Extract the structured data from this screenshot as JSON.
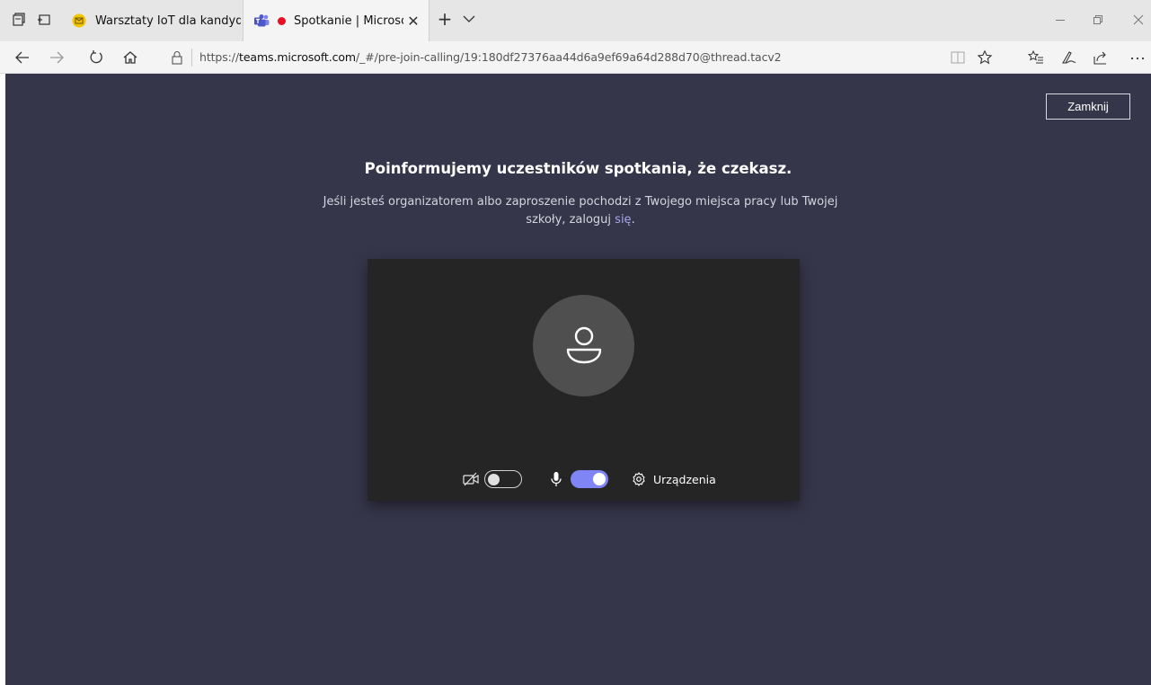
{
  "browser": {
    "tabs": [
      {
        "title": "Warsztaty IoT dla kandydatów",
        "active": false
      },
      {
        "title": "Spotkanie | Microsoft Teams",
        "active": true,
        "recording": true
      }
    ],
    "url_host_prefix": "https://",
    "url_host": "teams.microsoft.com",
    "url_path": "/_#/pre-join-calling/19:180df27376aa44d6a9ef69a64d288d70@thread.tacv2"
  },
  "page": {
    "close_label": "Zamknij",
    "headline": "Poinformujemy uczestników spotkania, że czekasz.",
    "subtitle_line1": "Jeśli jesteś organizatorem albo zaproszenie pochodzi z Twojego miejsca pracy lub Twojej",
    "subtitle_line2": "szkoły, zaloguj",
    "signin_link": "się",
    "subtitle_end": ".",
    "devices_label": "Urządzenia",
    "camera_on": false,
    "mic_on": true
  },
  "colors": {
    "page_bg": "#36364a",
    "video_bg": "#252525",
    "avatar_bg": "#4f4f4f",
    "accent": "#7f85f5",
    "link": "#a7a4e8",
    "recording": "#e81123"
  },
  "icons": [
    "tab-set-aside-icon",
    "tab-preview-icon",
    "new-tab-icon",
    "tab-dropdown-icon",
    "minimize-icon",
    "restore-icon",
    "close-window-icon",
    "back-icon",
    "forward-icon",
    "refresh-icon",
    "home-icon",
    "lock-icon",
    "reading-view-icon",
    "favorite-star-icon",
    "favorites-hub-icon",
    "pen-icon",
    "share-icon",
    "more-icon",
    "person-icon",
    "camera-off-icon",
    "microphone-icon",
    "gear-icon"
  ]
}
